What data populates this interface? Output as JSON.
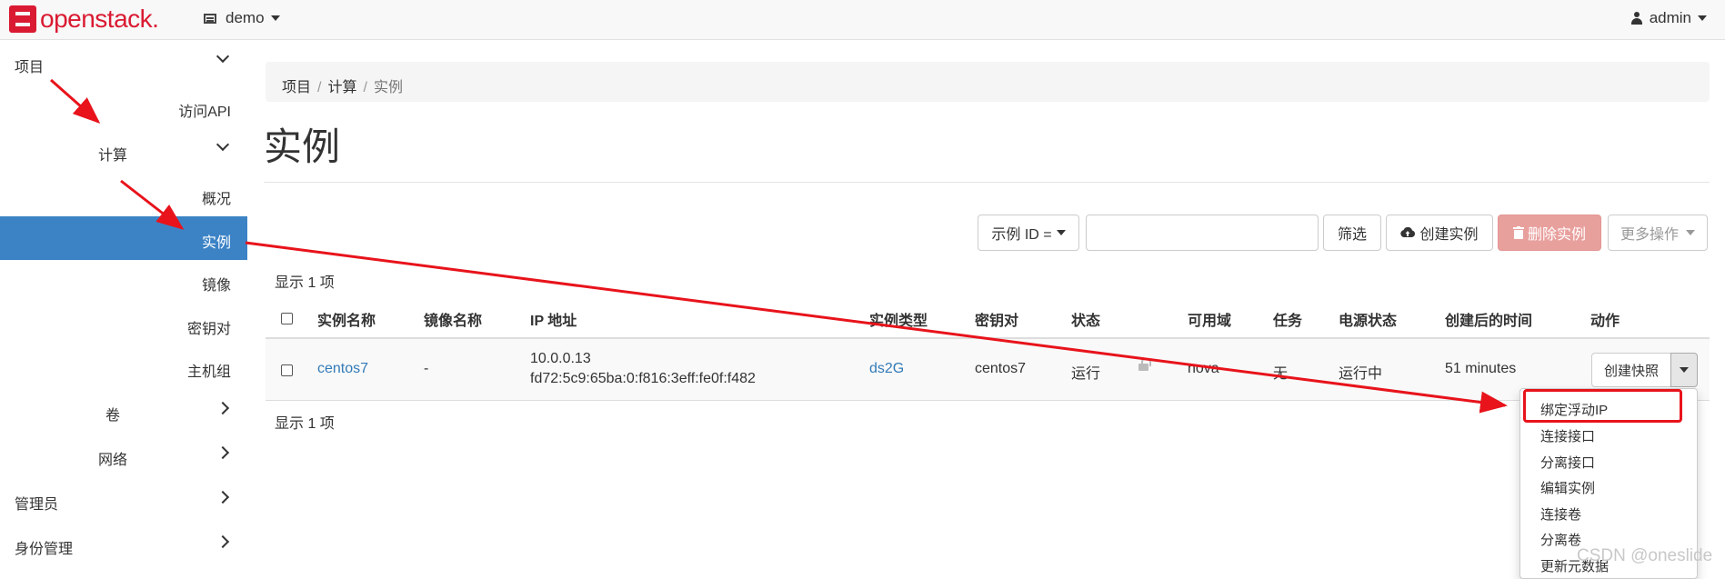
{
  "navbar": {
    "brand": "openstack.",
    "project": "demo",
    "user": "admin"
  },
  "sidebar": {
    "project": "项目",
    "access_api": "访问API",
    "compute": "计算",
    "overview": "概况",
    "instances": "实例",
    "images": "镜像",
    "key_pairs": "密钥对",
    "server_groups": "主机组",
    "volumes": "卷",
    "network": "网络",
    "admin": "管理员",
    "identity": "身份管理"
  },
  "breadcrumb": {
    "items": [
      "项目",
      "计算"
    ],
    "current": "实例",
    "separator": "/"
  },
  "page_title": "实例",
  "toolbar": {
    "filter_field": "示例 ID =",
    "filter_value": "",
    "filter_button": "筛选",
    "launch_button": "创建实例",
    "delete_button": "删除实例",
    "more_actions": "更多操作"
  },
  "summary": {
    "top": "显示 1 项",
    "bottom": "显示 1 项"
  },
  "table": {
    "headers": [
      "实例名称",
      "镜像名称",
      "IP 地址",
      "实例类型",
      "密钥对",
      "状态",
      "可用域",
      "任务",
      "电源状态",
      "创建后的时间",
      "动作"
    ],
    "row": {
      "name": "centos7",
      "image": "-",
      "ip_line1": "10.0.0.13",
      "ip_line2": "fd72:5c9:65ba:0:f816:3eff:fe0f:f482",
      "flavor": "ds2G",
      "key_pair": "centos7",
      "status": "运行",
      "availability_zone": "nova",
      "task": "无",
      "power_state": "运行中",
      "age": "51 minutes",
      "action": "创建快照"
    }
  },
  "action_menu": {
    "items": [
      "绑定浮动IP",
      "连接接口",
      "分离接口",
      "编辑实例",
      "连接卷",
      "分离卷",
      "更新元数据"
    ],
    "highlighted": "绑定浮动IP"
  },
  "watermark": "CSDN @oneslide",
  "colors": {
    "brand": "#da1a32",
    "active": "#3c83c6",
    "link": "#337ab7",
    "danger": "#e8a09d",
    "annotation": "#e8131b"
  }
}
